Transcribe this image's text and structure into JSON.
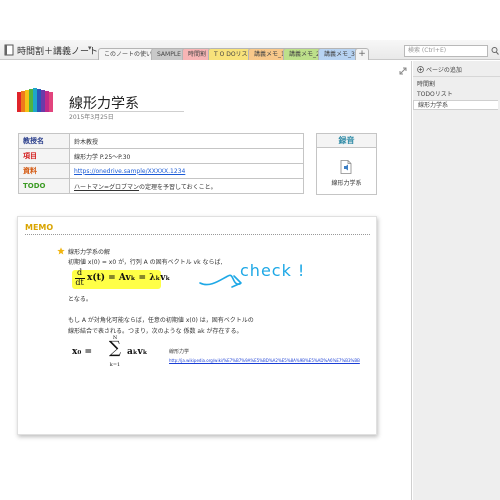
{
  "window": {
    "notebook_title": "時間割＋講義ノート",
    "notebook_dropdown": "▾"
  },
  "tabs": [
    {
      "label": "このノートの使い方",
      "color": "#f4f4f4"
    },
    {
      "label": "SAMPLE",
      "color": "#c9c9c9"
    },
    {
      "label": "時間割",
      "color": "#f7b5b5"
    },
    {
      "label": "T O DOリスト",
      "color": "#f8e27a"
    },
    {
      "label": "講義メモ_1",
      "color": "#f8c88a"
    },
    {
      "label": "講義メモ_2",
      "color": "#bde08a"
    },
    {
      "label": "講義メモ_3",
      "color": "#b7d3f2"
    }
  ],
  "tab_add_label": "+",
  "search": {
    "placeholder": "検索 (Ctrl+E)"
  },
  "page": {
    "title": "線形力学系",
    "date": "2015年3月25日"
  },
  "info_table": {
    "rows": [
      {
        "label": "教授名",
        "value": "鈴木教授"
      },
      {
        "label": "項目",
        "value": "線形力学 P.25～P.30"
      },
      {
        "label": "資料",
        "value": "https://onedrive.sample/XXXXX.1234"
      },
      {
        "label": "TODO",
        "value_underlined": "ハートマン=グロブマン",
        "value_rest": "の定理を予習しておくこと。"
      }
    ]
  },
  "recording": {
    "header": "録音",
    "file_name": "線形力学系",
    "file_icon": "audio-file-icon"
  },
  "memo": {
    "label": "MEMO",
    "heading": "線形力学系の解",
    "line1": "初期値 x(0) = x0 が，行列 A の固有ベクトル vk ならば,",
    "equation1_lhs": "d",
    "equation1_den": "dt",
    "equation1_rhs": "x(t) = Avₖ = λₖvₖ",
    "line2": "となる。",
    "annotation": "check !",
    "line3": "もし A が対角化可能ならば，任意の初期値 x(0) は，固有ベクトルの",
    "line4": "線形結合で表される。つまり，次のような 係数 ak が存在する。",
    "equation2_lhs": "x₀ =",
    "equation2_sum": "∑",
    "equation2_top": "N",
    "equation2_bottom": "k=1",
    "equation2_term": "aₖvₖ",
    "ref_label": "線形力学",
    "ref_url": "http://ja.wikipedia.org/wiki/%E7%B7%9A%E5%BD%A2%E5%8A%9B%E5%AD%A6%E7%B3%BB"
  },
  "right_panel": {
    "add_page": "ページの追加",
    "pages": [
      {
        "label": "時間割"
      },
      {
        "label": "TODOリスト"
      },
      {
        "label": "線形力学系"
      }
    ]
  }
}
